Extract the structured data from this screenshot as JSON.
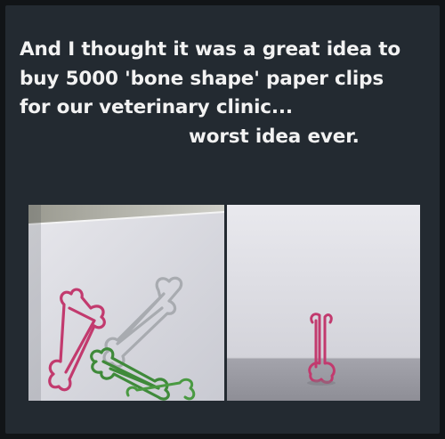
{
  "caption": {
    "line1": "And I thought it was a great idea to",
    "line2": "buy 5000 'bone shape' paper clips",
    "line3": "for our veterinary clinic...",
    "line4": "worst idea ever."
  },
  "photos": [
    {
      "subject": "bone-shaped paper clips on white paper",
      "clip_colors": [
        "#c23a6e",
        "#b9bcc0",
        "#3f8a3a"
      ]
    },
    {
      "subject": "single bone-shaped paper clip standing upright",
      "clip_colors": [
        "#c23a6e"
      ]
    }
  ]
}
